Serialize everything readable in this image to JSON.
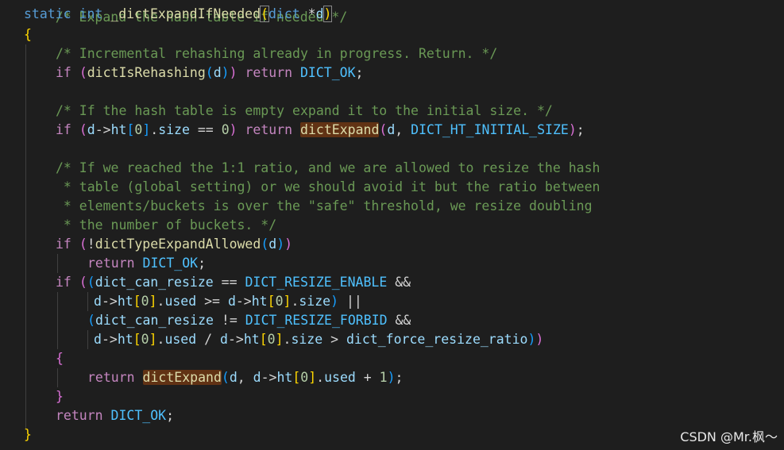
{
  "colors": {
    "background": "#1e1e1e",
    "keyword": "#569cd6",
    "control": "#c586c0",
    "function": "#dcdcaa",
    "variable": "#9cdcfe",
    "number": "#b5cea8",
    "macro": "#4fc1ff",
    "comment": "#6a9955",
    "bracket_level1": "#ffd700",
    "bracket_level2": "#da70d6",
    "bracket_level3": "#179fff",
    "highlight": "#613214"
  },
  "top_partial_comment": "/* Expand the hash table if needed */",
  "code": {
    "l1_static": "static",
    "l1_int": "int",
    "l1_fn": "_dictExpandIfNeeded",
    "l1_dict": "dict",
    "l1_star": "*",
    "l1_d": "d",
    "l2_brace": "{",
    "l3_comment": "/* Incremental rehashing already in progress. Return. */",
    "l4_if": "if",
    "l4_fn": "dictIsRehashing",
    "l4_d": "d",
    "l4_return": "return",
    "l4_ok": "DICT_OK",
    "l4_semi": ";",
    "l6_comment": "/* If the hash table is empty expand it to the initial size. */",
    "l7_if": "if",
    "l7_d": "d",
    "l7_arrow": "->",
    "l7_ht": "ht",
    "l7_zero": "0",
    "l7_dot": ".",
    "l7_size": "size",
    "l7_eq": " == ",
    "l7_zero2": "0",
    "l7_return": "return",
    "l7_fn": "dictExpand",
    "l7_d2": "d",
    "l7_comma": ", ",
    "l7_macro": "DICT_HT_INITIAL_SIZE",
    "l7_semi": ";",
    "l9_comment": "/* If we reached the 1:1 ratio, and we are allowed to resize the hash",
    "l10_comment": " * table (global setting) or we should avoid it but the ratio between",
    "l11_comment": " * elements/buckets is over the \"safe\" threshold, we resize doubling",
    "l12_comment": " * the number of buckets. */",
    "l13_if": "if",
    "l13_not": "!",
    "l13_fn": "dictTypeExpandAllowed",
    "l13_d": "d",
    "l14_return": "return",
    "l14_ok": "DICT_OK",
    "l14_semi": ";",
    "l15_if": "if",
    "l15_var": "dict_can_resize",
    "l15_eq": " == ",
    "l15_macro": "DICT_RESIZE_ENABLE",
    "l15_and": " &&",
    "l16_d": "d",
    "l16_arrow": "->",
    "l16_ht": "ht",
    "l16_zero": "0",
    "l16_used": "used",
    "l16_ge": " >= ",
    "l16_d2": "d",
    "l16_arrow2": "->",
    "l16_ht2": "ht",
    "l16_zero2": "0",
    "l16_size": "size",
    "l16_or": " ||",
    "l17_var": "dict_can_resize",
    "l17_ne": " != ",
    "l17_macro": "DICT_RESIZE_FORBID",
    "l17_and": " &&",
    "l18_d": "d",
    "l18_arrow": "->",
    "l18_ht": "ht",
    "l18_zero": "0",
    "l18_used": "used",
    "l18_div": " / ",
    "l18_d2": "d",
    "l18_arrow2": "->",
    "l18_ht2": "ht",
    "l18_zero2": "0",
    "l18_size": "size",
    "l18_gt": " > ",
    "l18_var": "dict_force_resize_ratio",
    "l19_brace": "{",
    "l20_return": "return",
    "l20_fn": "dictExpand",
    "l20_d": "d",
    "l20_d2": "d",
    "l20_arrow": "->",
    "l20_ht": "ht",
    "l20_zero": "0",
    "l20_used": "used",
    "l20_plus": " + ",
    "l20_one": "1",
    "l20_semi": ";",
    "l21_brace": "}",
    "l22_return": "return",
    "l22_ok": "DICT_OK",
    "l22_semi": ";",
    "l23_brace": "}"
  },
  "watermark": "CSDN @Mr.枫～"
}
